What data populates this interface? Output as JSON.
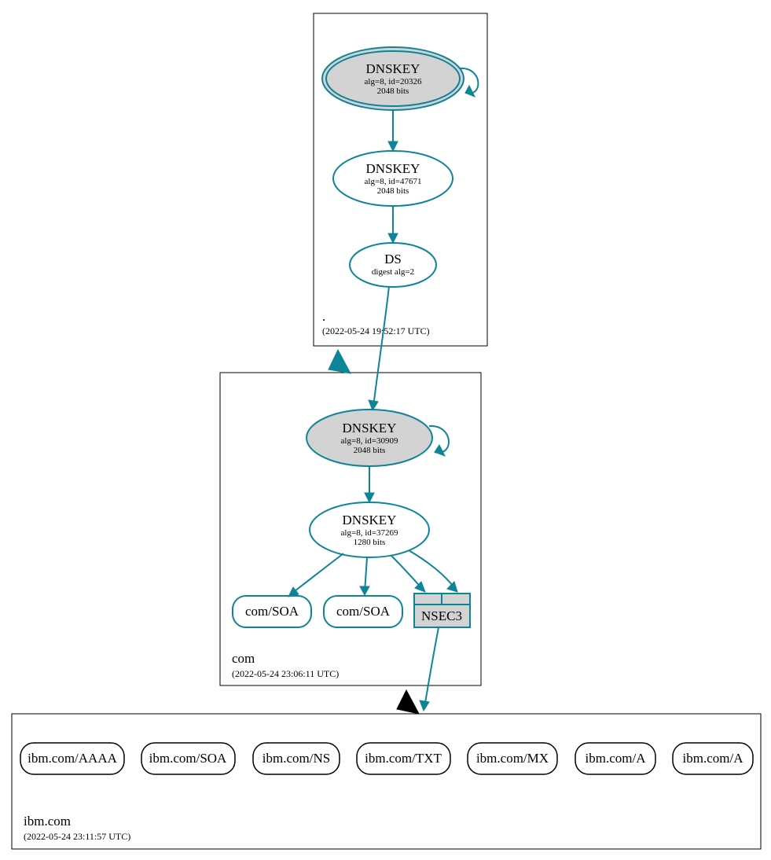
{
  "zones": {
    "root": {
      "label": ".",
      "timestamp": "(2022-05-24 19:52:17 UTC)"
    },
    "com": {
      "label": "com",
      "timestamp": "(2022-05-24 23:06:11 UTC)"
    },
    "ibm": {
      "label": "ibm.com",
      "timestamp": "(2022-05-24 23:11:57 UTC)"
    }
  },
  "nodes": {
    "root_ksk": {
      "title": "DNSKEY",
      "line1": "alg=8, id=20326",
      "line2": "2048 bits"
    },
    "root_zsk": {
      "title": "DNSKEY",
      "line1": "alg=8, id=47671",
      "line2": "2048 bits"
    },
    "root_ds": {
      "title": "DS",
      "line1": "digest alg=2"
    },
    "com_ksk": {
      "title": "DNSKEY",
      "line1": "alg=8, id=30909",
      "line2": "2048 bits"
    },
    "com_zsk": {
      "title": "DNSKEY",
      "line1": "alg=8, id=37269",
      "line2": "1280 bits"
    },
    "com_soa1": {
      "title": "com/SOA"
    },
    "com_soa2": {
      "title": "com/SOA"
    },
    "nsec3": {
      "title": "NSEC3"
    },
    "ibm_aaaa": {
      "title": "ibm.com/AAAA"
    },
    "ibm_soa": {
      "title": "ibm.com/SOA"
    },
    "ibm_ns": {
      "title": "ibm.com/NS"
    },
    "ibm_txt": {
      "title": "ibm.com/TXT"
    },
    "ibm_mx": {
      "title": "ibm.com/MX"
    },
    "ibm_a1": {
      "title": "ibm.com/A"
    },
    "ibm_a2": {
      "title": "ibm.com/A"
    }
  }
}
